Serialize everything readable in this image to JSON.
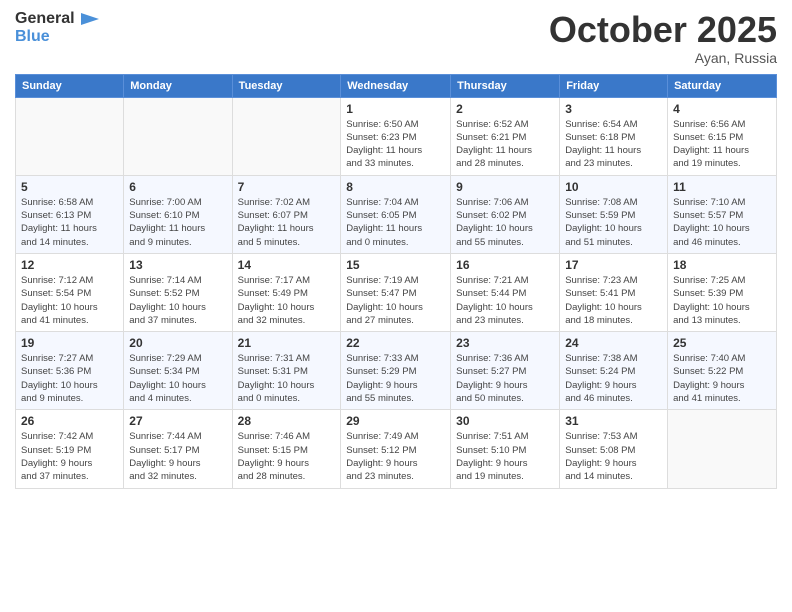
{
  "header": {
    "logo_general": "General",
    "logo_blue": "Blue",
    "month_title": "October 2025",
    "location": "Ayan, Russia"
  },
  "days_of_week": [
    "Sunday",
    "Monday",
    "Tuesday",
    "Wednesday",
    "Thursday",
    "Friday",
    "Saturday"
  ],
  "weeks": [
    [
      {
        "day": "",
        "info": ""
      },
      {
        "day": "",
        "info": ""
      },
      {
        "day": "",
        "info": ""
      },
      {
        "day": "1",
        "info": "Sunrise: 6:50 AM\nSunset: 6:23 PM\nDaylight: 11 hours\nand 33 minutes."
      },
      {
        "day": "2",
        "info": "Sunrise: 6:52 AM\nSunset: 6:21 PM\nDaylight: 11 hours\nand 28 minutes."
      },
      {
        "day": "3",
        "info": "Sunrise: 6:54 AM\nSunset: 6:18 PM\nDaylight: 11 hours\nand 23 minutes."
      },
      {
        "day": "4",
        "info": "Sunrise: 6:56 AM\nSunset: 6:15 PM\nDaylight: 11 hours\nand 19 minutes."
      }
    ],
    [
      {
        "day": "5",
        "info": "Sunrise: 6:58 AM\nSunset: 6:13 PM\nDaylight: 11 hours\nand 14 minutes."
      },
      {
        "day": "6",
        "info": "Sunrise: 7:00 AM\nSunset: 6:10 PM\nDaylight: 11 hours\nand 9 minutes."
      },
      {
        "day": "7",
        "info": "Sunrise: 7:02 AM\nSunset: 6:07 PM\nDaylight: 11 hours\nand 5 minutes."
      },
      {
        "day": "8",
        "info": "Sunrise: 7:04 AM\nSunset: 6:05 PM\nDaylight: 11 hours\nand 0 minutes."
      },
      {
        "day": "9",
        "info": "Sunrise: 7:06 AM\nSunset: 6:02 PM\nDaylight: 10 hours\nand 55 minutes."
      },
      {
        "day": "10",
        "info": "Sunrise: 7:08 AM\nSunset: 5:59 PM\nDaylight: 10 hours\nand 51 minutes."
      },
      {
        "day": "11",
        "info": "Sunrise: 7:10 AM\nSunset: 5:57 PM\nDaylight: 10 hours\nand 46 minutes."
      }
    ],
    [
      {
        "day": "12",
        "info": "Sunrise: 7:12 AM\nSunset: 5:54 PM\nDaylight: 10 hours\nand 41 minutes."
      },
      {
        "day": "13",
        "info": "Sunrise: 7:14 AM\nSunset: 5:52 PM\nDaylight: 10 hours\nand 37 minutes."
      },
      {
        "day": "14",
        "info": "Sunrise: 7:17 AM\nSunset: 5:49 PM\nDaylight: 10 hours\nand 32 minutes."
      },
      {
        "day": "15",
        "info": "Sunrise: 7:19 AM\nSunset: 5:47 PM\nDaylight: 10 hours\nand 27 minutes."
      },
      {
        "day": "16",
        "info": "Sunrise: 7:21 AM\nSunset: 5:44 PM\nDaylight: 10 hours\nand 23 minutes."
      },
      {
        "day": "17",
        "info": "Sunrise: 7:23 AM\nSunset: 5:41 PM\nDaylight: 10 hours\nand 18 minutes."
      },
      {
        "day": "18",
        "info": "Sunrise: 7:25 AM\nSunset: 5:39 PM\nDaylight: 10 hours\nand 13 minutes."
      }
    ],
    [
      {
        "day": "19",
        "info": "Sunrise: 7:27 AM\nSunset: 5:36 PM\nDaylight: 10 hours\nand 9 minutes."
      },
      {
        "day": "20",
        "info": "Sunrise: 7:29 AM\nSunset: 5:34 PM\nDaylight: 10 hours\nand 4 minutes."
      },
      {
        "day": "21",
        "info": "Sunrise: 7:31 AM\nSunset: 5:31 PM\nDaylight: 10 hours\nand 0 minutes."
      },
      {
        "day": "22",
        "info": "Sunrise: 7:33 AM\nSunset: 5:29 PM\nDaylight: 9 hours\nand 55 minutes."
      },
      {
        "day": "23",
        "info": "Sunrise: 7:36 AM\nSunset: 5:27 PM\nDaylight: 9 hours\nand 50 minutes."
      },
      {
        "day": "24",
        "info": "Sunrise: 7:38 AM\nSunset: 5:24 PM\nDaylight: 9 hours\nand 46 minutes."
      },
      {
        "day": "25",
        "info": "Sunrise: 7:40 AM\nSunset: 5:22 PM\nDaylight: 9 hours\nand 41 minutes."
      }
    ],
    [
      {
        "day": "26",
        "info": "Sunrise: 7:42 AM\nSunset: 5:19 PM\nDaylight: 9 hours\nand 37 minutes."
      },
      {
        "day": "27",
        "info": "Sunrise: 7:44 AM\nSunset: 5:17 PM\nDaylight: 9 hours\nand 32 minutes."
      },
      {
        "day": "28",
        "info": "Sunrise: 7:46 AM\nSunset: 5:15 PM\nDaylight: 9 hours\nand 28 minutes."
      },
      {
        "day": "29",
        "info": "Sunrise: 7:49 AM\nSunset: 5:12 PM\nDaylight: 9 hours\nand 23 minutes."
      },
      {
        "day": "30",
        "info": "Sunrise: 7:51 AM\nSunset: 5:10 PM\nDaylight: 9 hours\nand 19 minutes."
      },
      {
        "day": "31",
        "info": "Sunrise: 7:53 AM\nSunset: 5:08 PM\nDaylight: 9 hours\nand 14 minutes."
      },
      {
        "day": "",
        "info": ""
      }
    ]
  ]
}
